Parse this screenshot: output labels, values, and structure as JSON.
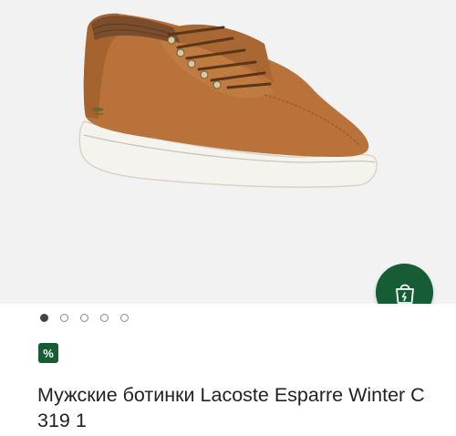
{
  "product": {
    "title": "Мужские ботинки Lacoste Esparre Winter C 319 1",
    "discount_badge": "%"
  },
  "gallery": {
    "image": "brown-leather-high-top-sneaker",
    "dots_count": 5,
    "active_dot": 1
  },
  "actions": {
    "add_to_cart_icon": "shopping-bag-icon"
  },
  "colors": {
    "accent": "#165c34",
    "background": "#f2f2f2",
    "shoe_leather": "#b8723a",
    "sole": "#f5f3ee"
  }
}
